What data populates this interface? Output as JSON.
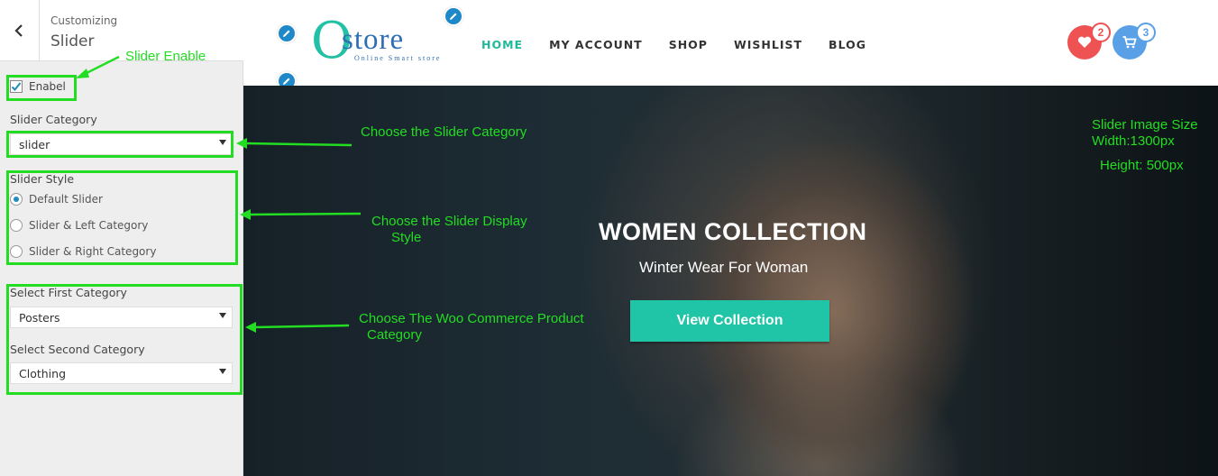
{
  "customizer": {
    "breadcrumb": "Customizing",
    "title": "Slider",
    "enable_label": "Enabel",
    "enable_checked": true,
    "slider_category_label": "Slider Category",
    "slider_category_value": "slider",
    "slider_style_label": "Slider Style",
    "slider_style_options": [
      "Default Slider",
      "Slider & Left Category",
      "Slider & Right Category"
    ],
    "slider_style_selected": "Default Slider",
    "first_category_label": "Select First Category",
    "first_category_value": "Posters",
    "second_category_label": "Select Second Category",
    "second_category_value": "Clothing"
  },
  "site": {
    "logo_letter": "O",
    "logo_word": "store",
    "logo_tagline": "Online Smart store",
    "nav": [
      "HOME",
      "MY ACCOUNT",
      "SHOP",
      "WISHLIST",
      "BLOG"
    ],
    "nav_active": "HOME",
    "wishlist_count": "2",
    "cart_count": "3",
    "hero": {
      "title": "WOMEN COLLECTION",
      "subtitle": "Winter Wear For Woman",
      "button": "View Collection"
    }
  },
  "annotations": {
    "slider_enable": "Slider Enable",
    "choose_category": "Choose the Slider Category",
    "choose_style_1": "Choose the Slider Display",
    "choose_style_2": "Style",
    "choose_product_1": "Choose The Woo Commerce Product",
    "choose_product_2": "Category",
    "image_size_1": "Slider Image Size",
    "image_size_2": "Width:1300px",
    "image_size_3": "Height: 500px"
  },
  "colors": {
    "accent": "#20c4a6",
    "annotation": "#22dd22",
    "wishlist": "#ee5253",
    "cart": "#5aa0e6",
    "link_blue": "#1e8cbe"
  },
  "icons": {
    "back": "chevron-left-icon",
    "edit": "pencil-icon",
    "wishlist": "heart-icon",
    "cart": "cart-icon",
    "dropdown": "caret-down-icon",
    "checkbox": "checkmark-icon"
  }
}
